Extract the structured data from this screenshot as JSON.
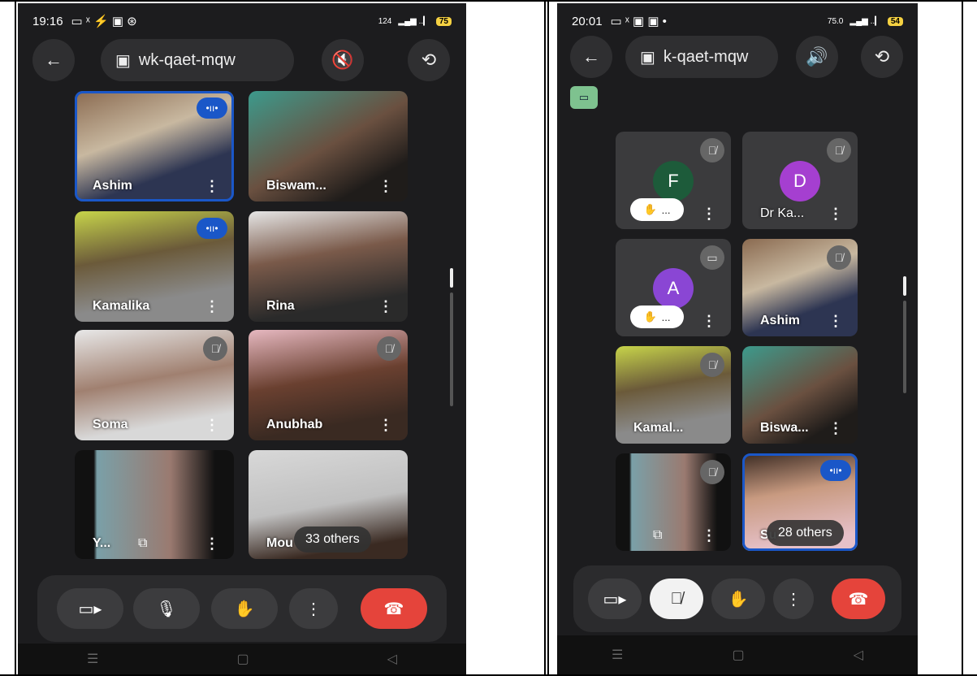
{
  "left": {
    "status": {
      "time": "19:16",
      "speed": "124",
      "battery": "75"
    },
    "meeting_code": "wk-qaet-mqw",
    "tiles": [
      {
        "name": "Ashim"
      },
      {
        "name": "Biswam..."
      },
      {
        "name": "Kamalika"
      },
      {
        "name": "Rina"
      },
      {
        "name": "Soma"
      },
      {
        "name": "Anubhab"
      },
      {
        "name": "Y..."
      },
      {
        "name": "Mou"
      }
    ],
    "others_label": "33 others"
  },
  "right": {
    "status": {
      "time": "20:01",
      "speed": "75.0",
      "battery": "54"
    },
    "meeting_code": "k-qaet-mqw",
    "tiles": [
      {
        "name": "",
        "initial": "F",
        "color": "#1d5b3a"
      },
      {
        "name": "Dr Ka...",
        "initial": "D",
        "color": "#a53fd0"
      },
      {
        "name": "",
        "initial": "A",
        "color": "#8a46d4"
      },
      {
        "name": "Ashim"
      },
      {
        "name": "Kamal..."
      },
      {
        "name": "Biswa..."
      },
      {
        "name": ""
      },
      {
        "name": "Su"
      }
    ],
    "hand_chip_label": "...",
    "others_label": "28 others"
  },
  "colors": {
    "end_call": "#e5443b",
    "active_outline": "#1a57c8",
    "background": "#1c1c1e"
  },
  "icons": [
    "back-arrow-icon",
    "calendar-icon",
    "speaker-off-icon",
    "speaker-icon",
    "camera-flip-icon",
    "camera-icon",
    "mic-icon",
    "mic-off-icon",
    "hand-icon",
    "more-vert-icon",
    "end-call-icon",
    "present-icon"
  ]
}
